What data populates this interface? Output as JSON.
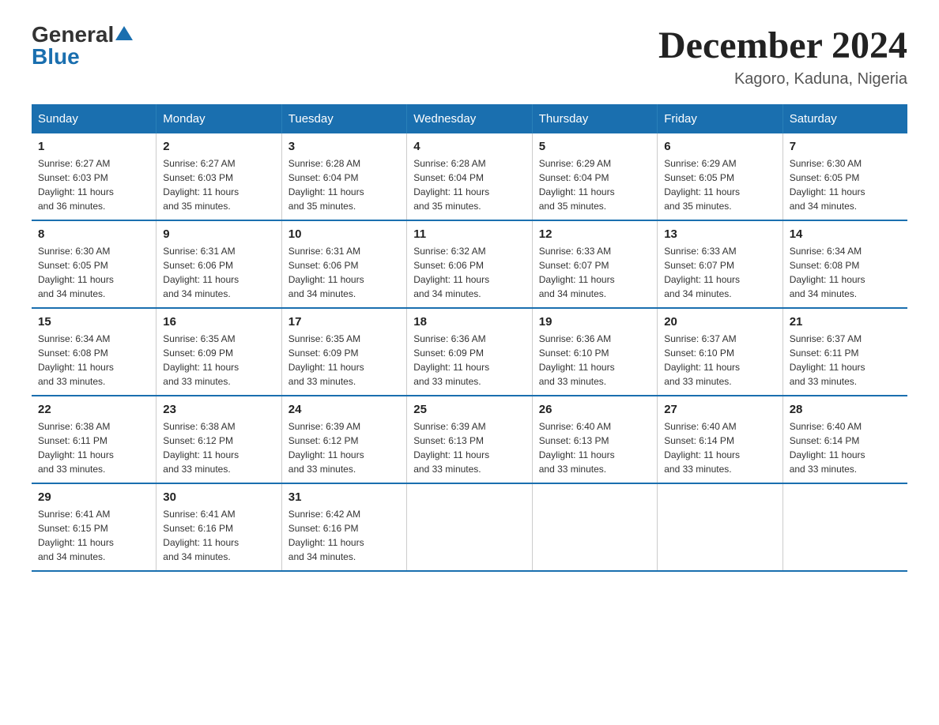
{
  "logo": {
    "general": "General",
    "blue": "Blue"
  },
  "title": "December 2024",
  "subtitle": "Kagoro, Kaduna, Nigeria",
  "days_of_week": [
    "Sunday",
    "Monday",
    "Tuesday",
    "Wednesday",
    "Thursday",
    "Friday",
    "Saturday"
  ],
  "weeks": [
    [
      {
        "day": "1",
        "sunrise": "6:27 AM",
        "sunset": "6:03 PM",
        "daylight": "11 hours and 36 minutes."
      },
      {
        "day": "2",
        "sunrise": "6:27 AM",
        "sunset": "6:03 PM",
        "daylight": "11 hours and 35 minutes."
      },
      {
        "day": "3",
        "sunrise": "6:28 AM",
        "sunset": "6:04 PM",
        "daylight": "11 hours and 35 minutes."
      },
      {
        "day": "4",
        "sunrise": "6:28 AM",
        "sunset": "6:04 PM",
        "daylight": "11 hours and 35 minutes."
      },
      {
        "day": "5",
        "sunrise": "6:29 AM",
        "sunset": "6:04 PM",
        "daylight": "11 hours and 35 minutes."
      },
      {
        "day": "6",
        "sunrise": "6:29 AM",
        "sunset": "6:05 PM",
        "daylight": "11 hours and 35 minutes."
      },
      {
        "day": "7",
        "sunrise": "6:30 AM",
        "sunset": "6:05 PM",
        "daylight": "11 hours and 34 minutes."
      }
    ],
    [
      {
        "day": "8",
        "sunrise": "6:30 AM",
        "sunset": "6:05 PM",
        "daylight": "11 hours and 34 minutes."
      },
      {
        "day": "9",
        "sunrise": "6:31 AM",
        "sunset": "6:06 PM",
        "daylight": "11 hours and 34 minutes."
      },
      {
        "day": "10",
        "sunrise": "6:31 AM",
        "sunset": "6:06 PM",
        "daylight": "11 hours and 34 minutes."
      },
      {
        "day": "11",
        "sunrise": "6:32 AM",
        "sunset": "6:06 PM",
        "daylight": "11 hours and 34 minutes."
      },
      {
        "day": "12",
        "sunrise": "6:33 AM",
        "sunset": "6:07 PM",
        "daylight": "11 hours and 34 minutes."
      },
      {
        "day": "13",
        "sunrise": "6:33 AM",
        "sunset": "6:07 PM",
        "daylight": "11 hours and 34 minutes."
      },
      {
        "day": "14",
        "sunrise": "6:34 AM",
        "sunset": "6:08 PM",
        "daylight": "11 hours and 34 minutes."
      }
    ],
    [
      {
        "day": "15",
        "sunrise": "6:34 AM",
        "sunset": "6:08 PM",
        "daylight": "11 hours and 33 minutes."
      },
      {
        "day": "16",
        "sunrise": "6:35 AM",
        "sunset": "6:09 PM",
        "daylight": "11 hours and 33 minutes."
      },
      {
        "day": "17",
        "sunrise": "6:35 AM",
        "sunset": "6:09 PM",
        "daylight": "11 hours and 33 minutes."
      },
      {
        "day": "18",
        "sunrise": "6:36 AM",
        "sunset": "6:09 PM",
        "daylight": "11 hours and 33 minutes."
      },
      {
        "day": "19",
        "sunrise": "6:36 AM",
        "sunset": "6:10 PM",
        "daylight": "11 hours and 33 minutes."
      },
      {
        "day": "20",
        "sunrise": "6:37 AM",
        "sunset": "6:10 PM",
        "daylight": "11 hours and 33 minutes."
      },
      {
        "day": "21",
        "sunrise": "6:37 AM",
        "sunset": "6:11 PM",
        "daylight": "11 hours and 33 minutes."
      }
    ],
    [
      {
        "day": "22",
        "sunrise": "6:38 AM",
        "sunset": "6:11 PM",
        "daylight": "11 hours and 33 minutes."
      },
      {
        "day": "23",
        "sunrise": "6:38 AM",
        "sunset": "6:12 PM",
        "daylight": "11 hours and 33 minutes."
      },
      {
        "day": "24",
        "sunrise": "6:39 AM",
        "sunset": "6:12 PM",
        "daylight": "11 hours and 33 minutes."
      },
      {
        "day": "25",
        "sunrise": "6:39 AM",
        "sunset": "6:13 PM",
        "daylight": "11 hours and 33 minutes."
      },
      {
        "day": "26",
        "sunrise": "6:40 AM",
        "sunset": "6:13 PM",
        "daylight": "11 hours and 33 minutes."
      },
      {
        "day": "27",
        "sunrise": "6:40 AM",
        "sunset": "6:14 PM",
        "daylight": "11 hours and 33 minutes."
      },
      {
        "day": "28",
        "sunrise": "6:40 AM",
        "sunset": "6:14 PM",
        "daylight": "11 hours and 33 minutes."
      }
    ],
    [
      {
        "day": "29",
        "sunrise": "6:41 AM",
        "sunset": "6:15 PM",
        "daylight": "11 hours and 34 minutes."
      },
      {
        "day": "30",
        "sunrise": "6:41 AM",
        "sunset": "6:16 PM",
        "daylight": "11 hours and 34 minutes."
      },
      {
        "day": "31",
        "sunrise": "6:42 AM",
        "sunset": "6:16 PM",
        "daylight": "11 hours and 34 minutes."
      },
      {
        "day": "",
        "sunrise": "",
        "sunset": "",
        "daylight": ""
      },
      {
        "day": "",
        "sunrise": "",
        "sunset": "",
        "daylight": ""
      },
      {
        "day": "",
        "sunrise": "",
        "sunset": "",
        "daylight": ""
      },
      {
        "day": "",
        "sunrise": "",
        "sunset": "",
        "daylight": ""
      }
    ]
  ],
  "labels": {
    "sunrise": "Sunrise:",
    "sunset": "Sunset:",
    "daylight": "Daylight:"
  }
}
